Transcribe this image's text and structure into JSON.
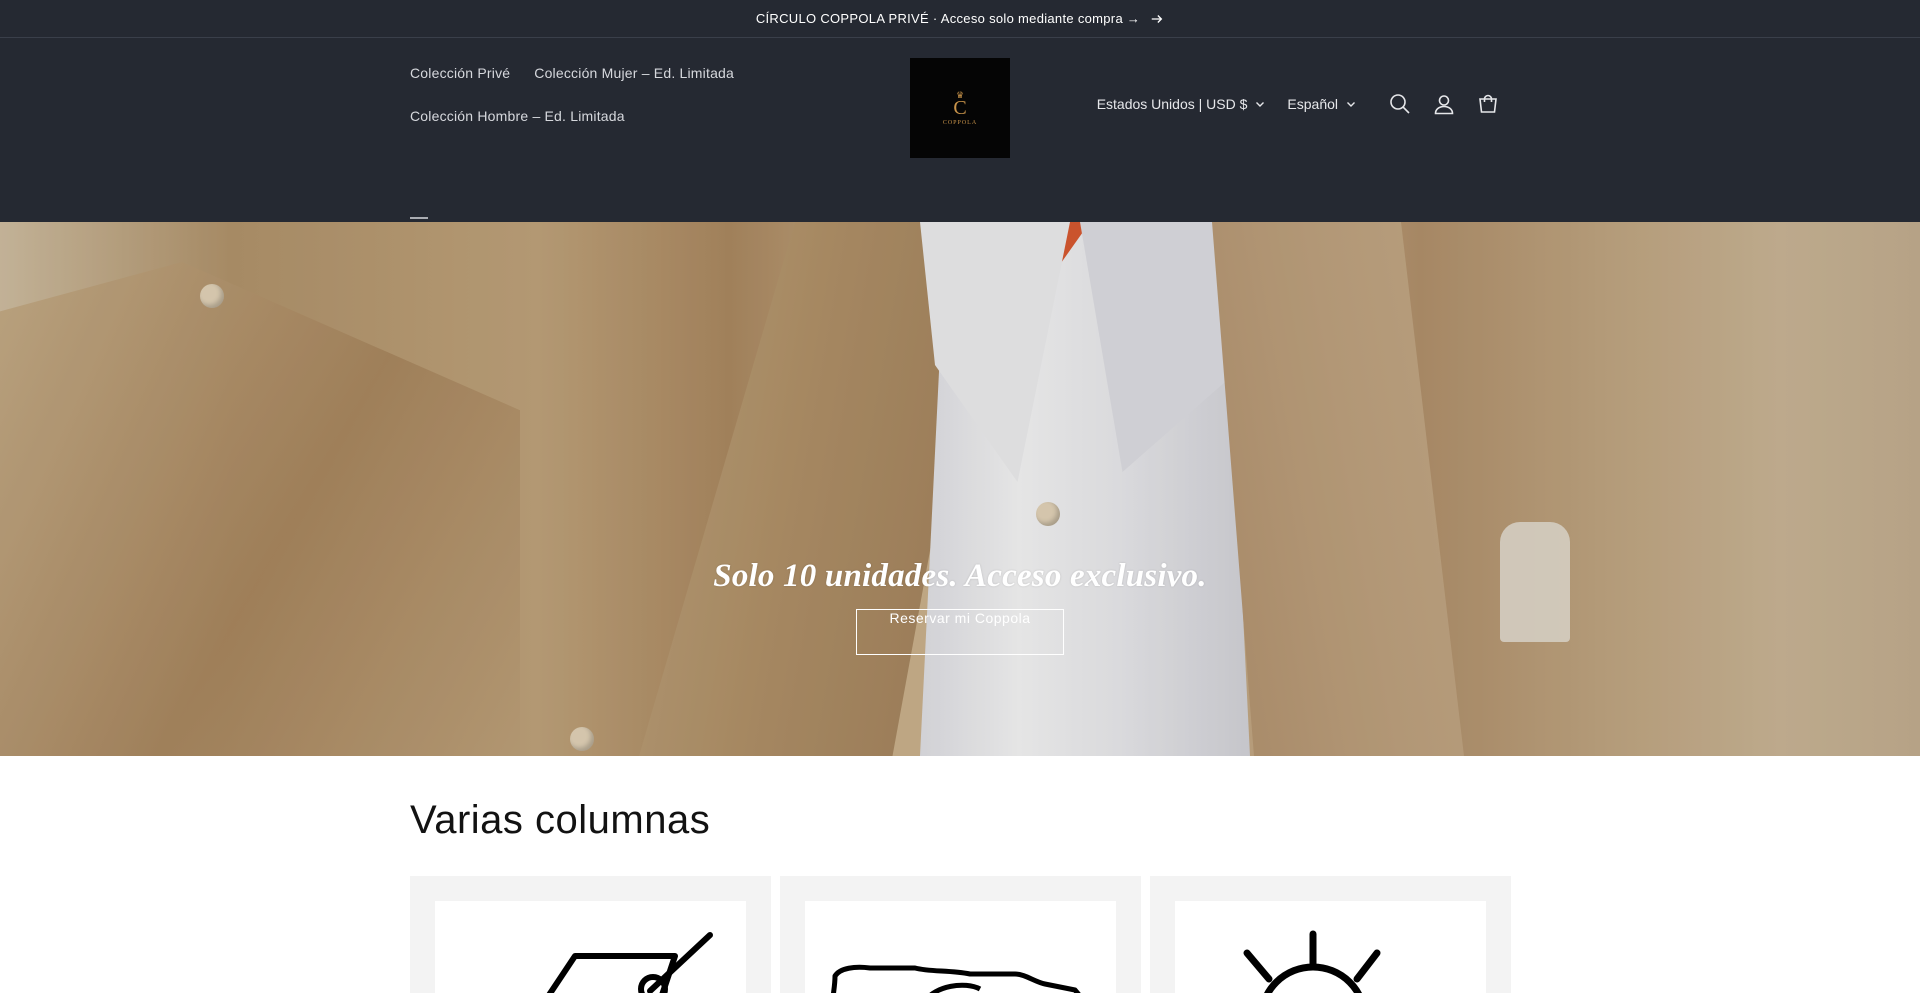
{
  "announcement": {
    "text": "CÍRCULO COPPOLA PRIVÉ · Acceso solo mediante compra →",
    "arrow_icon": "arrow-right-icon"
  },
  "header": {
    "nav": [
      {
        "label": "Colección Privé"
      },
      {
        "label": "Colección Mujer – Ed. Limitada"
      },
      {
        "label": "Colección Hombre – Ed. Limitada"
      }
    ],
    "menu_icon": "hamburger-menu-icon",
    "logo": {
      "mark": "C",
      "name": "COPPOLA",
      "crown_icon": "crown-icon"
    },
    "country_selector": "Estados Unidos | USD $",
    "language_selector": "Español",
    "icons": [
      "search-icon",
      "account-icon",
      "cart-icon"
    ]
  },
  "hero": {
    "title": "Solo 10 unidades. Acceso exclusivo.",
    "button_label": "Reservar mi Coppola"
  },
  "multicolumn": {
    "heading": "Varias columnas",
    "columns": [
      {
        "icon": "price-tag-icon"
      },
      {
        "icon": "map-icon"
      },
      {
        "icon": "sun-icon"
      }
    ]
  },
  "colors": {
    "header_bg": "#252932",
    "header_text": "#d6d8dd",
    "logo_gold": "#c9944a",
    "column_bg": "#f3f3f3"
  }
}
